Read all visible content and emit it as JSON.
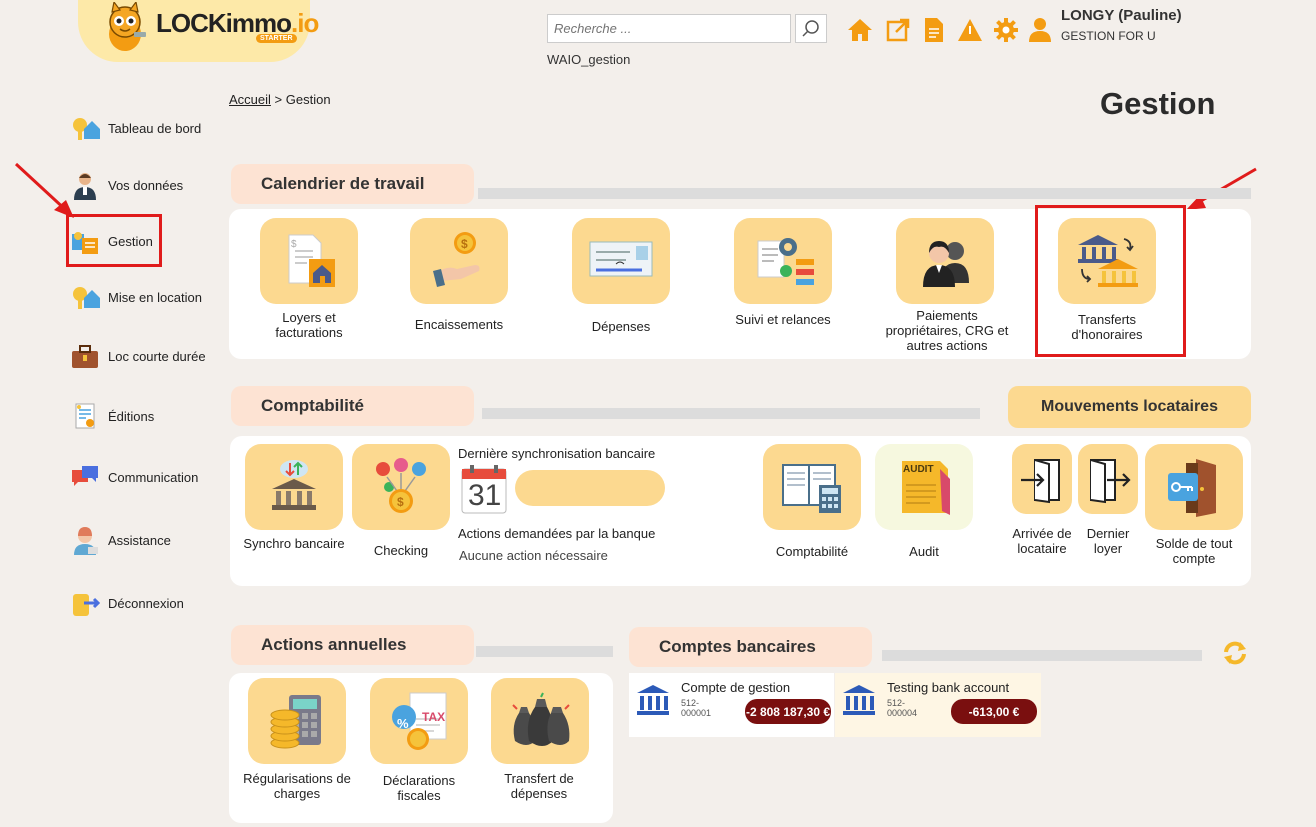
{
  "header": {
    "logo_name": "LOCKimmo",
    "logo_suffix": ".io",
    "logo_badge": "STARTER",
    "search_placeholder": "Recherche ...",
    "search_context": "WAIO_gestion",
    "user_name": "LONGY (Pauline)",
    "user_org": "GESTION FOR U",
    "icons": [
      "home-icon",
      "external-link-icon",
      "document-icon",
      "alert-icon",
      "gear-icon",
      "user-icon"
    ],
    "accent": "#f39c12"
  },
  "sidebar": {
    "items": [
      {
        "label": "Tableau de bord",
        "icon": "dashboard-icon"
      },
      {
        "label": "Vos données",
        "icon": "person-icon"
      },
      {
        "label": "Gestion",
        "icon": "management-icon"
      },
      {
        "label": "Mise en location",
        "icon": "rental-icon"
      },
      {
        "label": "Loc courte durée",
        "icon": "suitcase-icon"
      },
      {
        "label": "Éditions",
        "icon": "reports-icon"
      },
      {
        "label": "Communication",
        "icon": "chat-icon"
      },
      {
        "label": "Assistance",
        "icon": "support-icon"
      },
      {
        "label": "Déconnexion",
        "icon": "logout-icon"
      }
    ]
  },
  "breadcrumb": {
    "home": "Accueil",
    "separator": ">",
    "current": "Gestion"
  },
  "page_title": "Gestion",
  "calendrier": {
    "title": "Calendrier de travail",
    "tiles": [
      {
        "label": "Loyers et facturations",
        "icon": "invoice-house-icon"
      },
      {
        "label": "Encaissements",
        "icon": "hand-coin-icon"
      },
      {
        "label": "Dépenses",
        "icon": "cheque-icon"
      },
      {
        "label": "Suivi et relances",
        "icon": "followup-icon"
      },
      {
        "label": "Paiements propriétaires, CRG et autres actions",
        "icon": "owners-icon"
      },
      {
        "label": "Transferts d'honoraires",
        "icon": "bank-transfer-icon"
      }
    ]
  },
  "comptabilite": {
    "title": "Comptabilité",
    "synchro_label": "Synchro bancaire",
    "checking_label": "Checking",
    "last_sync_title": "Dernière synchronisation bancaire",
    "calendar_day": "31",
    "bank_actions_title": "Actions demandées par la banque",
    "bank_actions_value": "Aucune action nécessaire",
    "compta_label": "Comptabilité",
    "audit_label": "Audit",
    "audit_badge": "AUDIT"
  },
  "mouvements": {
    "title": "Mouvements locataires",
    "tiles": [
      {
        "label": "Arrivée de locataire",
        "icon": "door-enter-icon"
      },
      {
        "label": "Dernier loyer",
        "icon": "door-exit-icon"
      },
      {
        "label": "Solde de tout compte",
        "icon": "key-door-icon"
      }
    ]
  },
  "annuelles": {
    "title": "Actions annuelles",
    "tiles": [
      {
        "label": "Régularisations de charges",
        "icon": "calculator-coins-icon"
      },
      {
        "label": "Déclarations fiscales",
        "icon": "tax-icon"
      },
      {
        "label": "Transfert de dépenses",
        "icon": "money-bags-icon"
      }
    ],
    "tax_badge": "TAX",
    "percent_badge": "%"
  },
  "comptes": {
    "title": "Comptes bancaires",
    "accounts": [
      {
        "name": "Compte de gestion",
        "number_line1": "512-",
        "number_line2": "000001",
        "balance": "-2 808 187,30 €",
        "bg": "#ffffff"
      },
      {
        "name": "Testing bank account",
        "number_line1": "512-",
        "number_line2": "000004",
        "balance": "-613,00 €",
        "bg": "#fef6e4"
      }
    ]
  }
}
